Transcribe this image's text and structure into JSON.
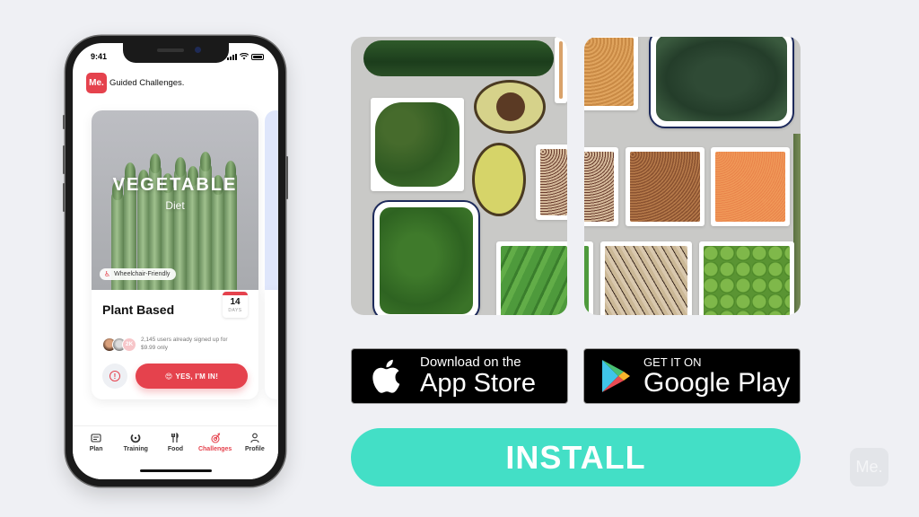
{
  "phone": {
    "status_bar": {
      "time": "9:41"
    },
    "app": {
      "logo_text": "Me.",
      "title": "Guided Challenges."
    },
    "challenge_card": {
      "hero_title": "VEGETABLE",
      "hero_subtitle": "Diet",
      "badge": {
        "icon": "wheelchair-icon",
        "label": "Wheelchair-Friendly"
      },
      "title": "Plant Based",
      "duration": {
        "value": "14",
        "unit": "DAYS"
      },
      "social_proof": {
        "extra_avatar_label": "2K",
        "text_line1": "2,145 users already signed up for",
        "text_line2": "$9.99 only"
      },
      "info_icon": "info-icon",
      "cta": {
        "emoji": "😍",
        "label": "YES, I'M IN!"
      }
    },
    "tab_bar": {
      "items": [
        {
          "label": "Plan",
          "icon": "plan-icon",
          "active": false
        },
        {
          "label": "Training",
          "icon": "training-icon",
          "active": false
        },
        {
          "label": "Food",
          "icon": "food-icon",
          "active": false
        },
        {
          "label": "Challenges",
          "icon": "challenges-icon",
          "active": true
        },
        {
          "label": "Profile",
          "icon": "profile-icon",
          "active": false
        }
      ]
    }
  },
  "stores": {
    "apple": {
      "line1": "Download on the",
      "line2": "App Store"
    },
    "google": {
      "line1": "GET IT ON",
      "line2": "Google Play"
    }
  },
  "install_button": {
    "label": "INSTALL"
  },
  "watermark": {
    "text": "Me."
  },
  "colors": {
    "brand_red": "#e5424d",
    "install_teal": "#43dfc6",
    "background": "#eff0f4"
  }
}
